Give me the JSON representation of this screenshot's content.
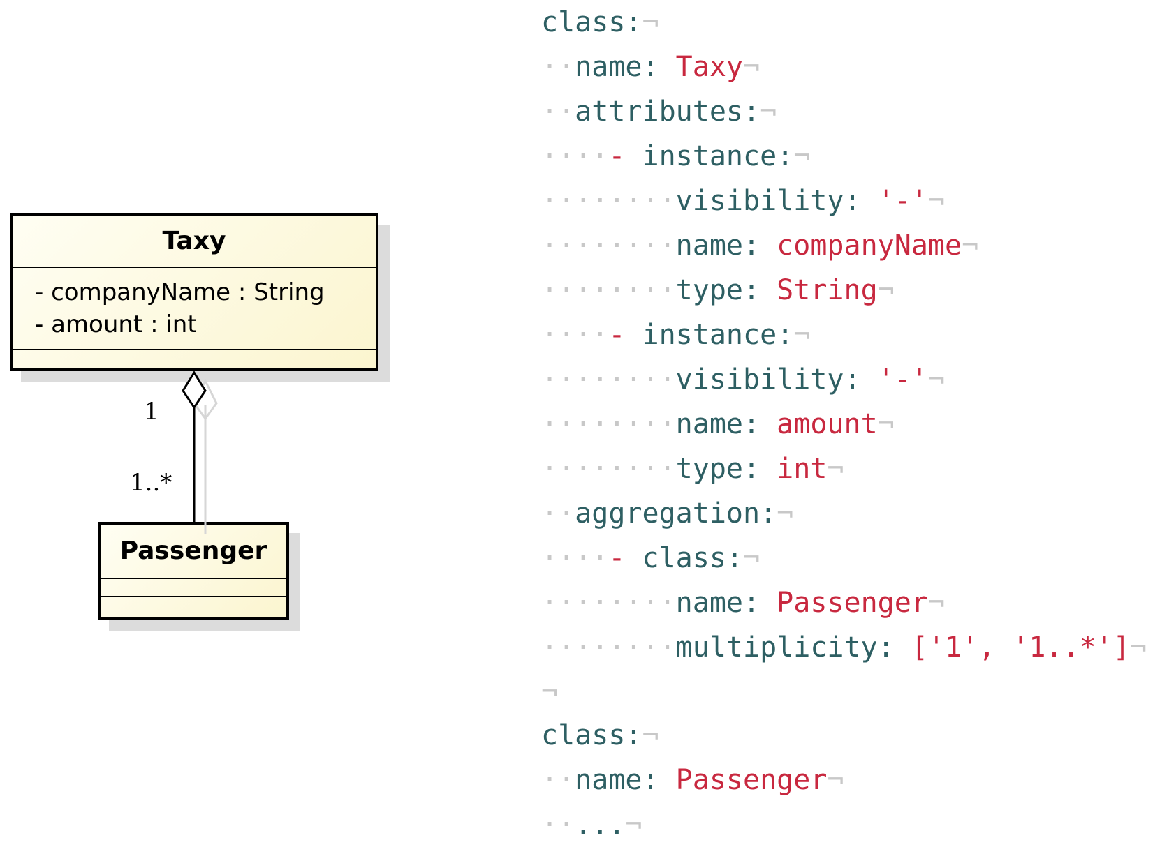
{
  "uml": {
    "taxy": {
      "title": "Taxy",
      "attributes": [
        "- companyName : String",
        "- amount : int"
      ]
    },
    "passenger": {
      "title": "Passenger"
    },
    "aggregation": {
      "source_multiplicity": "1",
      "target_multiplicity": "1..*"
    }
  },
  "code_lines": [
    {
      "indent": "",
      "dash": "",
      "key": "class:",
      "value": ""
    },
    {
      "indent": "··",
      "dash": "",
      "key": "name: ",
      "value": "Taxy"
    },
    {
      "indent": "··",
      "dash": "",
      "key": "attributes:",
      "value": ""
    },
    {
      "indent": "····",
      "dash": "- ",
      "key": "instance:",
      "value": ""
    },
    {
      "indent": "········",
      "dash": "",
      "key": "visibility: ",
      "value": "'-'"
    },
    {
      "indent": "········",
      "dash": "",
      "key": "name: ",
      "value": "companyName"
    },
    {
      "indent": "········",
      "dash": "",
      "key": "type: ",
      "value": "String"
    },
    {
      "indent": "····",
      "dash": "- ",
      "key": "instance:",
      "value": ""
    },
    {
      "indent": "········",
      "dash": "",
      "key": "visibility: ",
      "value": "'-'"
    },
    {
      "indent": "········",
      "dash": "",
      "key": "name: ",
      "value": "amount"
    },
    {
      "indent": "········",
      "dash": "",
      "key": "type: ",
      "value": "int"
    },
    {
      "indent": "··",
      "dash": "",
      "key": "aggregation:",
      "value": ""
    },
    {
      "indent": "····",
      "dash": "- ",
      "key": "class:",
      "value": ""
    },
    {
      "indent": "········",
      "dash": "",
      "key": "name: ",
      "value": "Passenger"
    },
    {
      "indent": "········",
      "dash": "",
      "key": "multiplicity: ",
      "value": "['1', '1..*']"
    },
    {
      "indent": "",
      "dash": "",
      "key": "",
      "value": ""
    },
    {
      "indent": "",
      "dash": "",
      "key": "class:",
      "value": ""
    },
    {
      "indent": "··",
      "dash": "",
      "key": "name: ",
      "value": "Passenger"
    },
    {
      "indent": "··",
      "dash": "",
      "key": "...",
      "value": ""
    }
  ],
  "pilcrow": "¬"
}
